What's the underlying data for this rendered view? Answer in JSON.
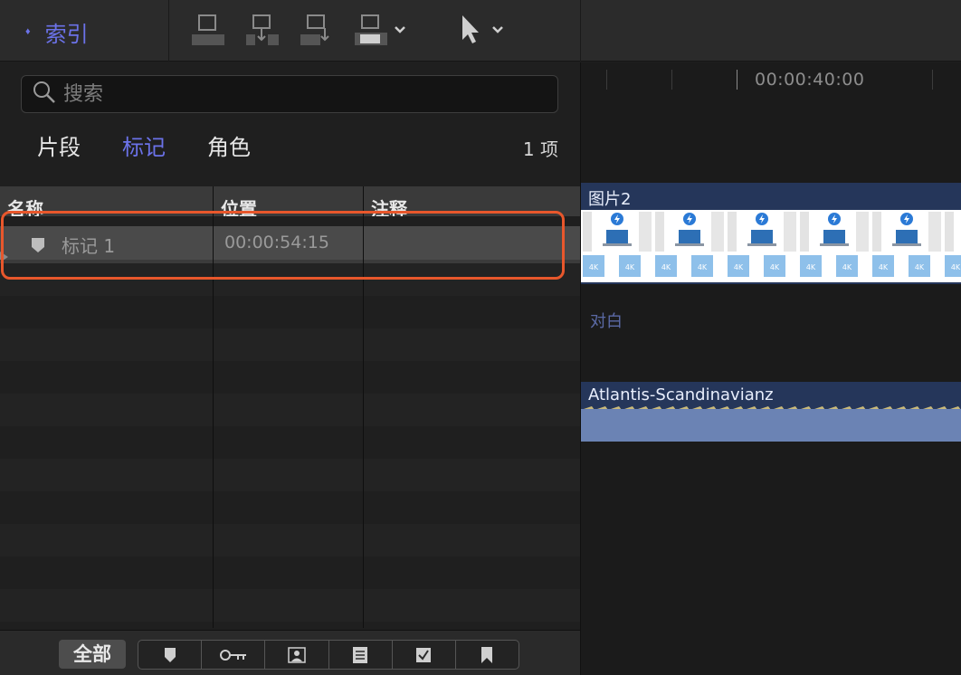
{
  "toolbar": {
    "index_label": "索引",
    "icons": [
      "connect-clip-icon",
      "insert-clip-icon",
      "append-clip-icon",
      "overwrite-clip-icon",
      "select-tool-icon"
    ]
  },
  "browser": {
    "search_placeholder": "搜索",
    "tabs": [
      {
        "label": "片段",
        "active": false
      },
      {
        "label": "标记",
        "active": true
      },
      {
        "label": "角色",
        "active": false
      }
    ],
    "count_label": "1 项",
    "columns": [
      "名称",
      "位置",
      "注释"
    ],
    "rows": [
      {
        "name": "标记 1",
        "position": "00:00:54:15",
        "notes": ""
      }
    ],
    "footer": {
      "all_label": "全部",
      "filters": [
        "marker-icon",
        "keyword-icon",
        "person-icon",
        "todo-list-icon",
        "checked-icon",
        "bookmark-icon"
      ]
    }
  },
  "timeline": {
    "timecode": "00:00:40:00",
    "video_clip_title": "图片2",
    "dialogue_label": "对白",
    "audio_clip_title": "Atlantis-Scandinavianz"
  },
  "colors": {
    "accent": "#6b72e8",
    "highlight": "#e8572c",
    "clip_bg": "#25365a"
  }
}
